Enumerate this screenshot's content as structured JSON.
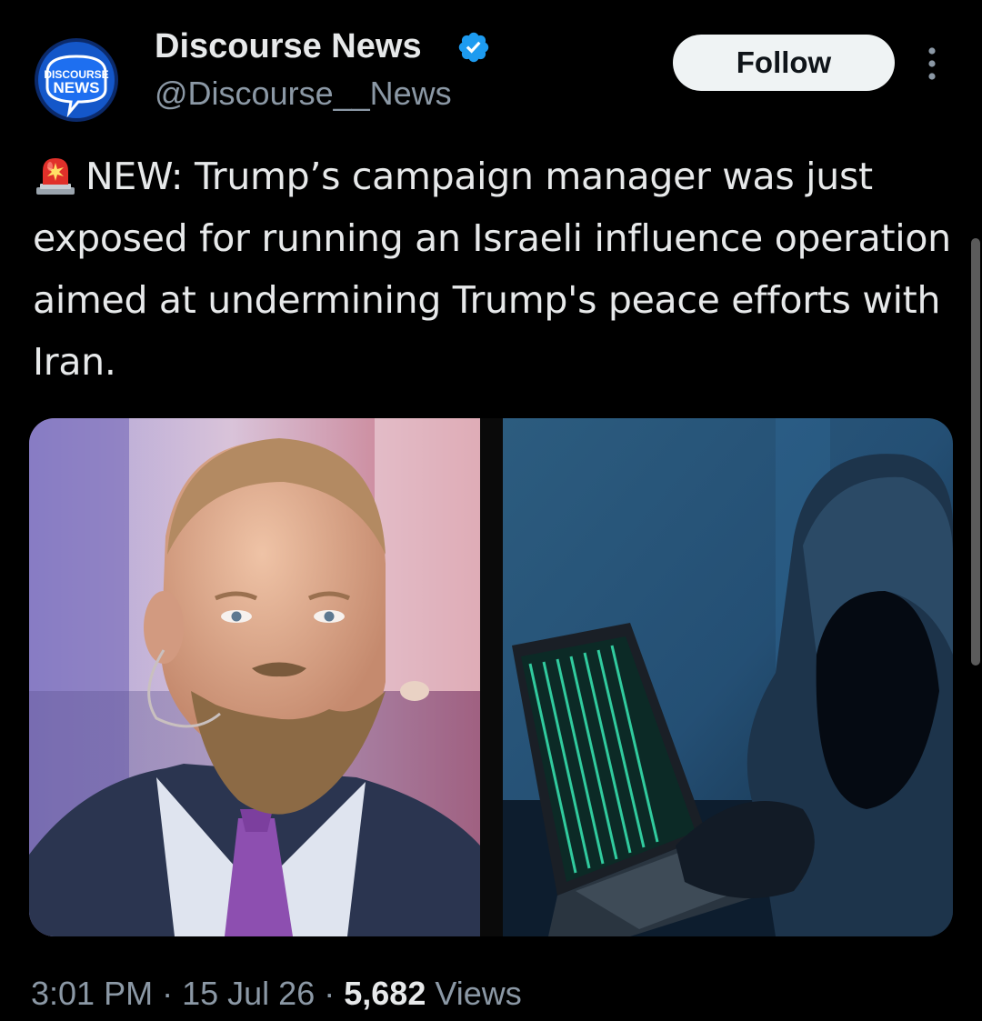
{
  "author": {
    "display_name": "Discourse News",
    "handle": "@Discourse__News",
    "verified": true,
    "verified_color": "#1d9bf0",
    "avatar_text_line1": "DISCOURSE",
    "avatar_text_line2": "NEWS"
  },
  "follow_button": {
    "label": "Follow"
  },
  "more_menu": {
    "icon": "more-vertical-icon"
  },
  "tweet": {
    "emoji_icon": "police-siren-icon",
    "text": "NEW: Trump’s campaign manager was just exposed for running an Israeli influence operation aimed at undermining Trump's peace efforts with Iran."
  },
  "media": [
    {
      "description_icon": "photo-man-with-beard"
    },
    {
      "description_icon": "photo-hooded-hacker-laptop"
    }
  ],
  "meta": {
    "time": "3:01 PM",
    "separator": "·",
    "date": "15 Jul 26",
    "views_count": "5,682",
    "views_label": "Views"
  },
  "colors": {
    "background": "#000000",
    "text_primary": "#e7e9ea",
    "text_secondary": "#8b98a5",
    "follow_bg": "#eff3f4"
  }
}
